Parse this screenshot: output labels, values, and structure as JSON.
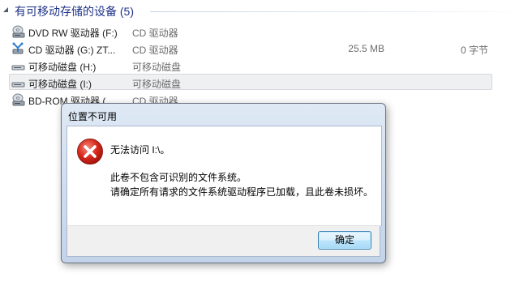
{
  "group": {
    "title": "有可移动存储的设备 (5)"
  },
  "devices": [
    {
      "name": "DVD RW 驱动器 (F:)",
      "type": "CD 驱动器",
      "size": "",
      "free": "",
      "icon": "dvd-drive-icon"
    },
    {
      "name": "CD 驱动器 (G:) ZT...",
      "type": "CD 驱动器",
      "size": "25.5 MB",
      "free": "0 字节",
      "icon": "cd-drive-icon"
    },
    {
      "name": "可移动磁盘 (H:)",
      "type": "可移动磁盘",
      "size": "",
      "free": "",
      "icon": "removable-disk-icon"
    },
    {
      "name": "可移动磁盘 (I:)",
      "type": "可移动磁盘",
      "size": "",
      "free": "",
      "icon": "removable-disk-icon"
    },
    {
      "name": "BD-ROM 驱动器 (...",
      "type": "CD 驱动器",
      "size": "",
      "free": "",
      "icon": "bd-rom-drive-icon"
    }
  ],
  "dialog": {
    "title": "位置不可用",
    "message": "无法访问 I:\\。",
    "detail_line1": "此卷不包含可识别的文件系统。",
    "detail_line2": "请确定所有请求的文件系统驱动程序已加载，且此卷未损坏。",
    "ok_label": "确定",
    "icon": "error-icon"
  }
}
